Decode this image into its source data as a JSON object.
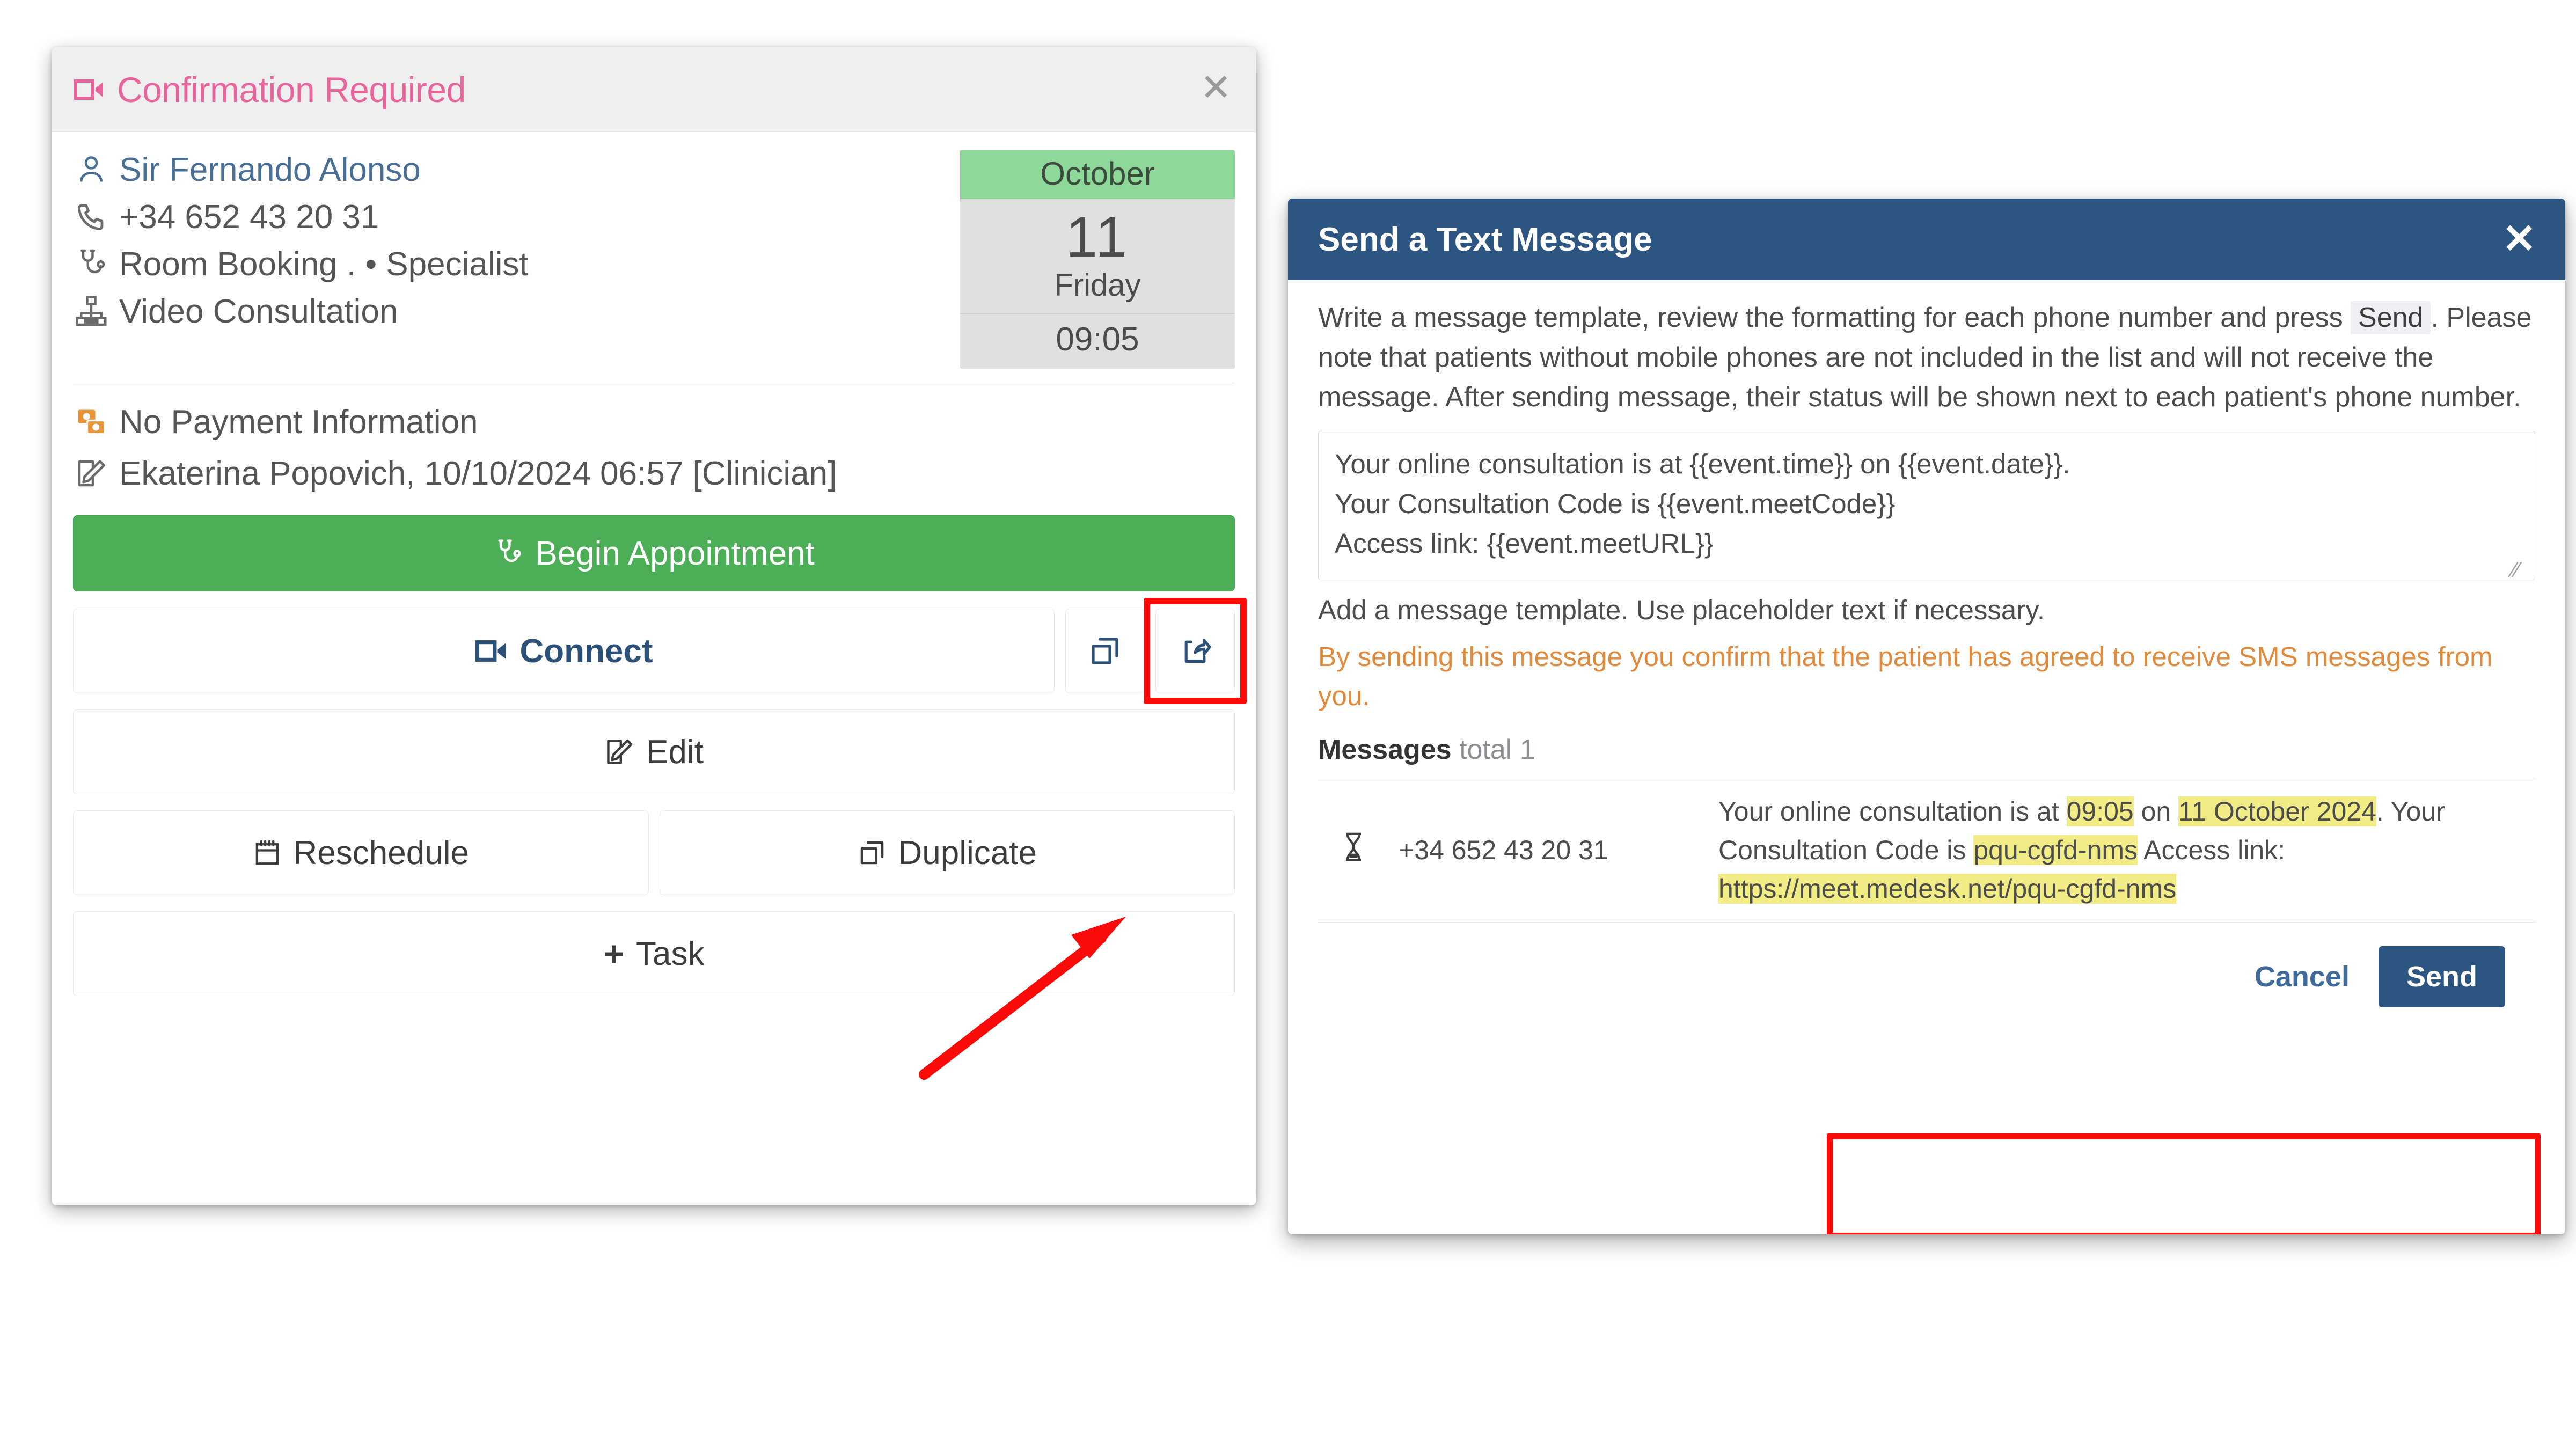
{
  "appointment": {
    "header": {
      "title": "Confirmation Required",
      "icon": "video-camera-icon",
      "close_label": "✕",
      "title_color": "#e8659b"
    },
    "info": [
      {
        "icon": "user-icon",
        "text": "Sir Fernando Alonso"
      },
      {
        "icon": "phone-icon",
        "text": "+34 652 43 20 31"
      },
      {
        "icon": "stethoscope-icon",
        "text": "Room Booking . • Specialist"
      },
      {
        "icon": "sitemap-icon",
        "text": "Video Consultation"
      }
    ],
    "date_badge": {
      "month": "October",
      "day": "11",
      "weekday": "Friday",
      "time": "09:05",
      "month_bg": "#8ed89a",
      "body_bg": "#e0e0e0"
    },
    "meta": [
      {
        "icon": "payment-icon",
        "text": "No Payment Information"
      },
      {
        "icon": "edit-note-icon",
        "text": "Ekaterina Popovich, 10/10/2024 06:57 [Clinician]"
      }
    ],
    "actions": {
      "begin": "Begin Appointment",
      "begin_color": "#4caf58",
      "connect": "Connect",
      "duplicate_icon_button": "duplicate-icon",
      "share_icon_button": "share-icon",
      "edit": "Edit",
      "reschedule": "Reschedule",
      "duplicate": "Duplicate",
      "task": "+ Task",
      "task_label": "Task"
    },
    "annotation": {
      "highlight_color": "#fb0a0a",
      "highlight_target": "share-icon-button",
      "arrow_points_to": "share-icon-button"
    }
  },
  "sms_modal": {
    "title": "Send a Text Message",
    "close_label": "✕",
    "header_color": "#2d5582",
    "intro": {
      "before_kbd": "Write a message template, review the formatting for each phone number and press ",
      "kbd": "Send",
      "after_kbd": ". Please note that patients without mobile phones are not included in the list and will not receive the message. After sending message, their status will be shown next to each patient's phone number."
    },
    "template": {
      "lines": [
        "Your online consultation is at {{event.time}} on {{event.date}}.",
        "Your Consultation Code is {{event.meetCode}}",
        "Access link: {{event.meetURL}}"
      ]
    },
    "hint": "Add a message template. Use placeholder text if necessary.",
    "warning": "By sending this message you confirm that the patient has agreed to receive SMS messages from you.",
    "warning_color": "#e08a3c",
    "messages_header": {
      "label": "Messages",
      "total": "total 1"
    },
    "messages": [
      {
        "status_icon": "hourglass-icon",
        "phone": "+34 652 43 20 31",
        "parts": [
          {
            "t": "Your online consultation is at ",
            "hl": false
          },
          {
            "t": "09:05",
            "hl": true
          },
          {
            "t": " on ",
            "hl": false
          },
          {
            "t": "11 October 2024",
            "hl": true
          },
          {
            "t": ". Your Consultation Code is ",
            "hl": false
          },
          {
            "t": "pqu-cgfd-nms",
            "hl": true
          },
          {
            "t": " Access link: ",
            "hl": false
          },
          {
            "t": "https://meet.medesk.net/pqu-cgfd-nms",
            "hl": true
          }
        ],
        "highlight_color": "#f2ec86"
      }
    ],
    "footer": {
      "cancel": "Cancel",
      "send": "Send",
      "send_color": "#2d5582"
    },
    "annotation": {
      "highlight_color": "#fb0a0a",
      "highlight_target": "message-cell"
    }
  }
}
